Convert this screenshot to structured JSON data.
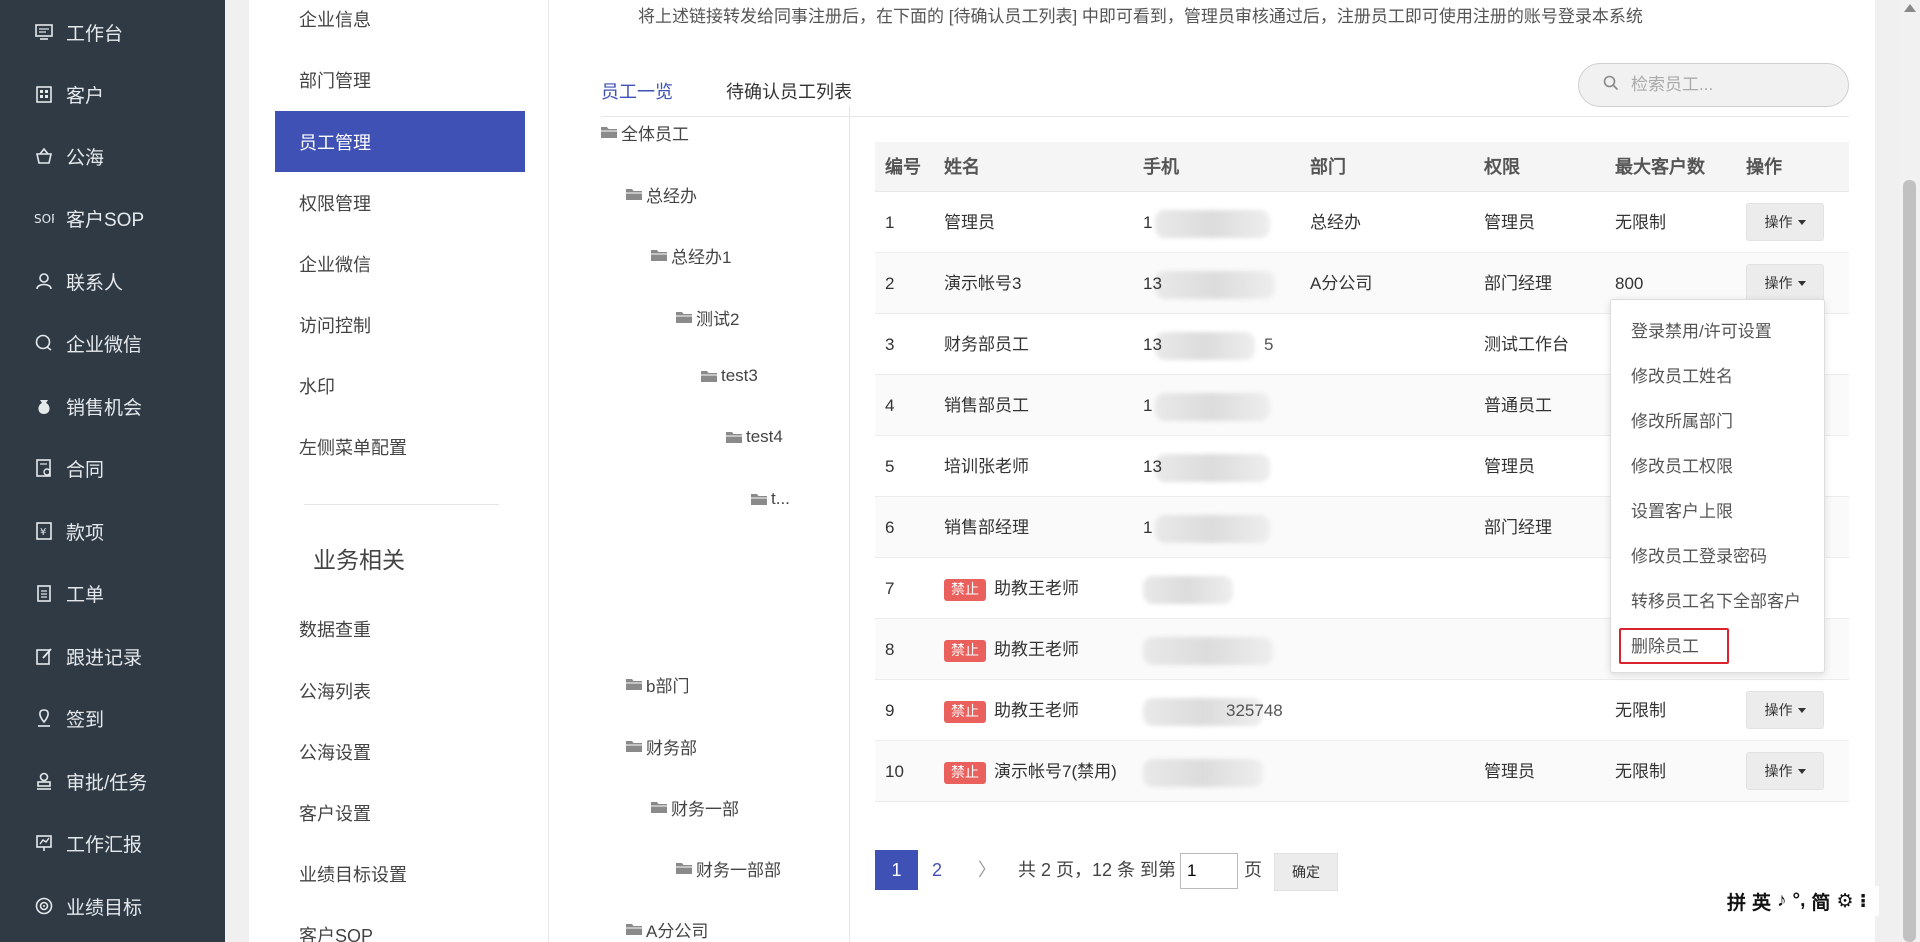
{
  "nav": {
    "items": [
      {
        "label": "工作台",
        "icon": "monitor-icon"
      },
      {
        "label": "客户",
        "icon": "building-icon"
      },
      {
        "label": "公海",
        "icon": "basket-icon"
      },
      {
        "label": "客户SOP",
        "icon": "sop-icon"
      },
      {
        "label": "联系人",
        "icon": "person-icon"
      },
      {
        "label": "企业微信",
        "icon": "chat-icon"
      },
      {
        "label": "销售机会",
        "icon": "money-bag-icon"
      },
      {
        "label": "合同",
        "icon": "contract-icon"
      },
      {
        "label": "款项",
        "icon": "payment-icon"
      },
      {
        "label": "工单",
        "icon": "clipboard-icon"
      },
      {
        "label": "跟进记录",
        "icon": "edit-icon"
      },
      {
        "label": "签到",
        "icon": "location-icon"
      },
      {
        "label": "审批/任务",
        "icon": "stamp-icon"
      },
      {
        "label": "工作汇报",
        "icon": "report-icon"
      },
      {
        "label": "业绩目标",
        "icon": "target-icon"
      }
    ]
  },
  "settings": {
    "items": [
      {
        "label": "企业信息"
      },
      {
        "label": "部门管理"
      },
      {
        "label": "员工管理",
        "active": true
      },
      {
        "label": "权限管理"
      },
      {
        "label": "企业微信"
      },
      {
        "label": "访问控制"
      },
      {
        "label": "水印"
      },
      {
        "label": "左侧菜单配置"
      }
    ],
    "group_title": "业务相关",
    "group_items": [
      {
        "label": "数据查重"
      },
      {
        "label": "公海列表"
      },
      {
        "label": "公海设置"
      },
      {
        "label": "客户设置"
      },
      {
        "label": "业绩目标设置"
      },
      {
        "label": "客户SOP"
      }
    ]
  },
  "notice": "将上述链接转发给同事注册后，在下面的 [待确认员工列表] 中即可看到，管理员审核通过后，注册员工即可使用注册的账号登录本系统",
  "tabs": {
    "all": "员工一览",
    "pending": "待确认员工列表"
  },
  "search": {
    "placeholder": "检索员工..."
  },
  "tree": [
    {
      "label": "全体员工"
    },
    {
      "label": "总经办"
    },
    {
      "label": "总经办1"
    },
    {
      "label": "测试2"
    },
    {
      "label": "test3"
    },
    {
      "label": "test4"
    },
    {
      "label": "t..."
    },
    {
      "label": "b部门"
    },
    {
      "label": "财务部"
    },
    {
      "label": "财务一部"
    },
    {
      "label": "财务一部部"
    },
    {
      "label": "A分公司"
    }
  ],
  "table": {
    "headers": [
      "编号",
      "姓名",
      "手机",
      "部门",
      "权限",
      "最大客户数",
      "操作"
    ],
    "op_label": "操作",
    "banned_label": "禁止",
    "rows": [
      {
        "no": "1",
        "name": "管理员",
        "phone": "1",
        "dept": "总经办",
        "role": "管理员",
        "max": "无限制",
        "banned": false,
        "op": true
      },
      {
        "no": "2",
        "name": "演示帐号3",
        "phone": "13",
        "dept": "A分公司",
        "role": "部门经理",
        "max": "800",
        "banned": false,
        "op": true
      },
      {
        "no": "3",
        "name": "财务部员工",
        "phone": "13",
        "phone_tail": "5",
        "dept": "",
        "role": "测试工作台",
        "max": "",
        "banned": false,
        "op": false
      },
      {
        "no": "4",
        "name": "销售部员工",
        "phone": "1",
        "dept": "",
        "role": "普通员工",
        "max": "",
        "banned": false,
        "op": false
      },
      {
        "no": "5",
        "name": "培训张老师",
        "phone": "13",
        "dept": "",
        "role": "管理员",
        "max": "",
        "banned": false,
        "op": false
      },
      {
        "no": "6",
        "name": "销售部经理",
        "phone": "1",
        "dept": "",
        "role": "部门经理",
        "max": "",
        "banned": false,
        "op": false
      },
      {
        "no": "7",
        "name": "助教王老师",
        "phone": "",
        "dept": "",
        "role": "",
        "max": "",
        "banned": true,
        "op": false
      },
      {
        "no": "8",
        "name": "助教王老师",
        "phone": "",
        "dept": "",
        "role": "",
        "max": "",
        "banned": true,
        "op": false
      },
      {
        "no": "9",
        "name": "助教王老师",
        "phone": "",
        "phone_tail": "325748",
        "dept": "",
        "role": "",
        "max": "无限制",
        "banned": true,
        "op": true
      },
      {
        "no": "10",
        "name": "演示帐号7(禁用)",
        "phone": "",
        "dept": "",
        "role": "管理员",
        "max": "无限制",
        "banned": true,
        "op": true
      }
    ]
  },
  "dropdown": {
    "items": [
      "登录禁用/许可设置",
      "修改员工姓名",
      "修改所属部门",
      "修改员工权限",
      "设置客户上限",
      "修改员工登录密码",
      "转移员工名下全部客户",
      "删除员工"
    ],
    "highlight_color": "#d9232e"
  },
  "pagination": {
    "current": "1",
    "page2": "2",
    "next": "〉",
    "summary": "共 2 页，12 条  到第",
    "goto_value": "1",
    "unit": "页",
    "confirm": "确定"
  },
  "ime": {
    "items": [
      "拼",
      "英",
      "♪",
      "°,",
      "简",
      "⚙",
      "⁝"
    ]
  },
  "colors": {
    "nav_bg": "#2f3a45",
    "accent": "#3f51b5",
    "banned": "#e9605c"
  }
}
